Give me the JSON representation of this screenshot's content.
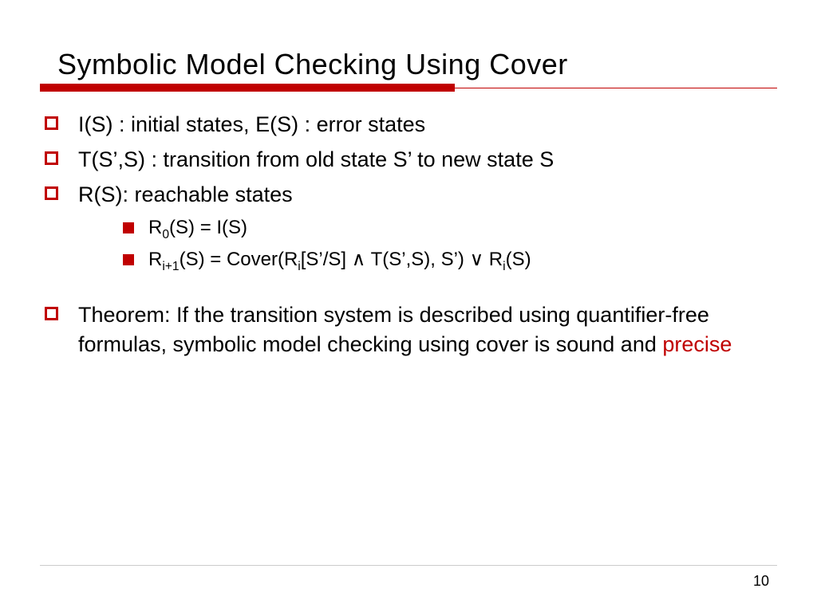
{
  "title": "Symbolic Model Checking Using Cover",
  "bullets": {
    "b1": "I(S) : initial states,    E(S) : error states",
    "b2": "T(S’,S) : transition from old state S’ to new state S",
    "b3": "R(S): reachable states",
    "sub1_pre": "R",
    "sub1_sub": "0",
    "sub1_post": "(S) = I(S)",
    "sub2_a": "R",
    "sub2_a_sub": "i+1",
    "sub2_b": "(S) = Cover(R",
    "sub2_b_sub": "i",
    "sub2_c": "[S’/S] ∧ T(S’,S), S’) ∨ R",
    "sub2_c_sub": "i",
    "sub2_d": "(S)",
    "b4_main": "Theorem: If the transition system is described using quantifier-free formulas, symbolic model checking using cover is sound and ",
    "b4_hl": "precise"
  },
  "page_number": "10"
}
